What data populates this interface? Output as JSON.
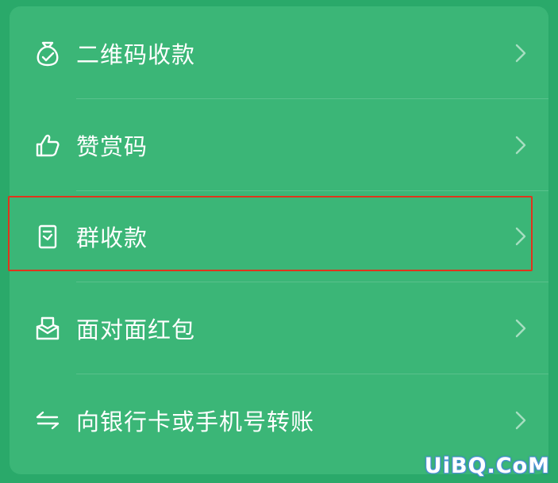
{
  "menu": {
    "items": [
      {
        "label": "二维码收款",
        "icon": "money-bag-icon"
      },
      {
        "label": "赞赏码",
        "icon": "thumbs-up-icon"
      },
      {
        "label": "群收款",
        "icon": "receipt-icon",
        "highlighted": true
      },
      {
        "label": "面对面红包",
        "icon": "red-packet-icon"
      },
      {
        "label": "向银行卡或手机号转账",
        "icon": "transfer-icon"
      }
    ]
  },
  "watermark": "UiBQ.CoM",
  "colors": {
    "background": "#2aa96a",
    "card": "#3bb677",
    "text": "#ffffff",
    "highlight_border": "#e0341c"
  }
}
